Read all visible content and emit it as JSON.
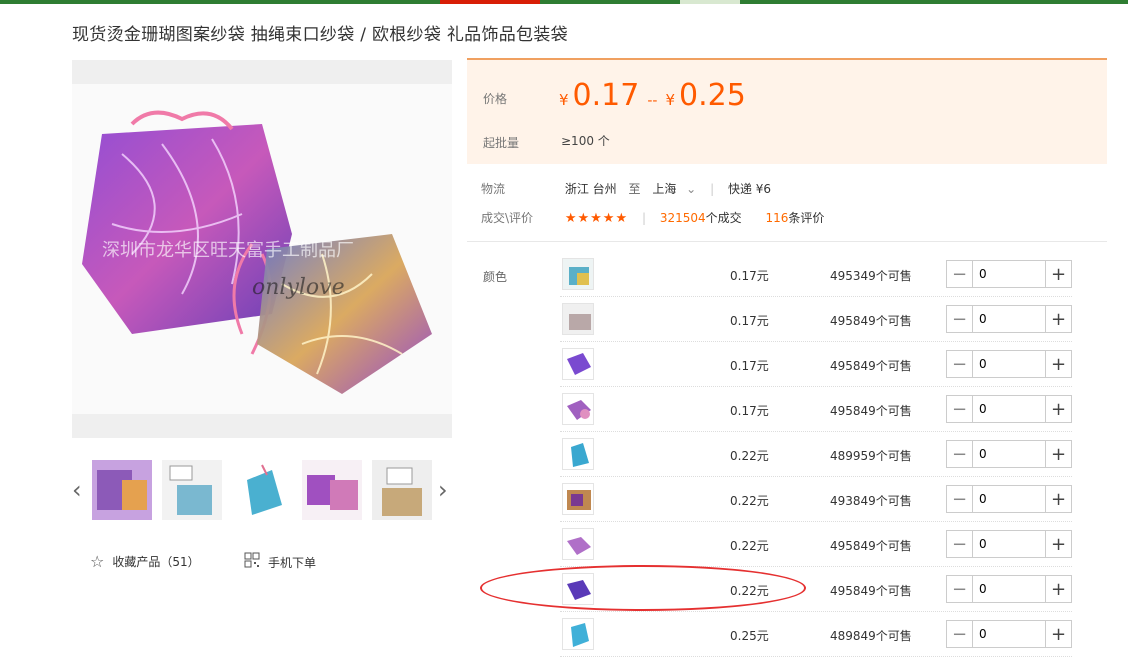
{
  "title": "现货烫金珊瑚图案纱袋 抽绳束口纱袋 / 欧根纱袋 礼品饰品包装袋",
  "watermark": {
    "cn": "深圳市龙华区旺天富手工制品厂",
    "en": "onlylove"
  },
  "actions": {
    "favorite": "收藏产品（51）",
    "mobile": "手机下单"
  },
  "icons": {
    "favorite": "star-outline-icon",
    "mobile": "qr-code-icon",
    "prev": "chevron-left-icon",
    "next": "chevron-right-icon"
  },
  "price": {
    "label": "价格",
    "currency": "¥",
    "low": "0.17",
    "sep": "--",
    "high": "0.25",
    "moq_label": "起批量",
    "moq": "≥100 个"
  },
  "shipping": {
    "label": "物流",
    "from": "浙江 台州",
    "to_word": "至",
    "to": "上海",
    "express": "快递 ¥6",
    "review_label": "成交\\评价",
    "stars": "★★★★★",
    "deals_num": "321504",
    "deals_suffix": "个成交",
    "reviews_num": "116",
    "reviews_suffix": "条评价"
  },
  "colors_label": "颜色",
  "skus": [
    {
      "price": "0.17元",
      "stock": "495349个可售",
      "qty": "0"
    },
    {
      "price": "0.17元",
      "stock": "495849个可售",
      "qty": "0"
    },
    {
      "price": "0.17元",
      "stock": "495849个可售",
      "qty": "0"
    },
    {
      "price": "0.17元",
      "stock": "495849个可售",
      "qty": "0"
    },
    {
      "price": "0.22元",
      "stock": "489959个可售",
      "qty": "0"
    },
    {
      "price": "0.22元",
      "stock": "493849个可售",
      "qty": "0"
    },
    {
      "price": "0.22元",
      "stock": "495849个可售",
      "qty": "0"
    },
    {
      "price": "0.22元",
      "stock": "495849个可售",
      "qty": "0"
    },
    {
      "price": "0.25元",
      "stock": "489849个可售",
      "qty": "0"
    }
  ],
  "qty_controls": {
    "minus": "−",
    "plus": "+"
  },
  "colors": {
    "accent": "#ff5a00",
    "topbar": "#2e7d32",
    "annotation": "#e53030"
  }
}
